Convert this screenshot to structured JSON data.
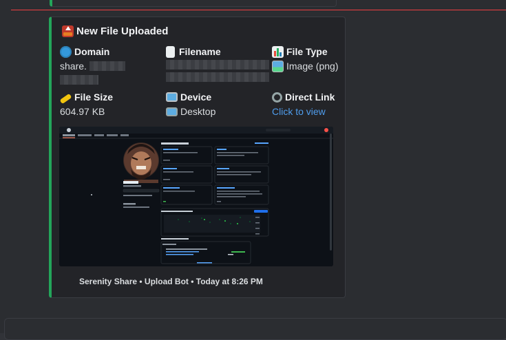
{
  "embed": {
    "title": "New File Uploaded",
    "fields": [
      {
        "name": "Domain",
        "icon": "globe-icon",
        "value": "share."
      },
      {
        "name": "Filename",
        "icon": "page-icon",
        "value": ""
      },
      {
        "name": "File Type",
        "icon": "bar-chart-icon",
        "value": "Image (png)",
        "value_icon": "picture-icon"
      },
      {
        "name": "File Size",
        "icon": "ruler-icon",
        "value": "604.97 KB"
      },
      {
        "name": "Device",
        "icon": "monitor-icon",
        "value": "Desktop",
        "value_icon": "laptop-icon"
      },
      {
        "name": "Direct Link",
        "icon": "link-icon",
        "value": "Click to view"
      }
    ],
    "footer": "Serenity Share • Upload Bot • Today at 8:26 PM",
    "accent": "#23a55a"
  },
  "screenshot": {
    "tabs": [
      "Overview",
      "Repositories",
      "Projects",
      "Packages",
      "Stars"
    ],
    "profile_name": "Ragnar",
    "section": "Popular repositories",
    "highlights": "Highlights"
  }
}
